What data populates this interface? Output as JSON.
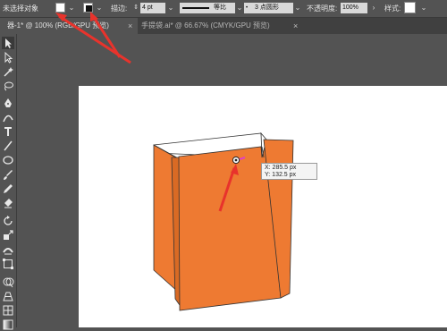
{
  "control_bar": {
    "selection_status": "未选择对象",
    "stroke_label": "描边:",
    "stroke_value": "4 pt",
    "profile_label": "等比",
    "brush_value": "3 点圆形",
    "opacity_label": "不透明度:",
    "opacity_value": "100%",
    "style_label": "样式:"
  },
  "tabs": [
    {
      "label": "器-1* @ 100% (RGB/GPU 预览)",
      "active": true
    },
    {
      "label": "手提袋.ai* @ 66.67% (CMYK/GPU 预览)",
      "active": false
    }
  ],
  "tab_close_glyph": "×",
  "cursor_readout": {
    "x": "X: 285.5 px",
    "y": "Y: 132.5 px"
  },
  "colors": {
    "bag_orange": "#ee7a32",
    "bag_dark_orange": "#d96a24",
    "annotation_red": "#e8332c",
    "anchor_magenta": "#e040c0",
    "ui_panel": "#535353",
    "tab_bar": "#404040"
  },
  "toolbar_tools": [
    "selection-tool-icon",
    "direct-selection-tool-icon",
    "magic-wand-icon",
    "lasso-icon",
    "pen-tool-icon",
    "curvature-tool-icon",
    "type-tool-icon",
    "line-tool-icon",
    "ellipse-tool-icon",
    "paintbrush-icon",
    "pencil-icon",
    "eraser-icon",
    "rotate-tool-icon",
    "scale-tool-icon",
    "width-tool-icon",
    "free-transform-icon",
    "shape-builder-icon",
    "perspective-grid-icon",
    "mesh-tool-icon",
    "gradient-tool-icon"
  ]
}
